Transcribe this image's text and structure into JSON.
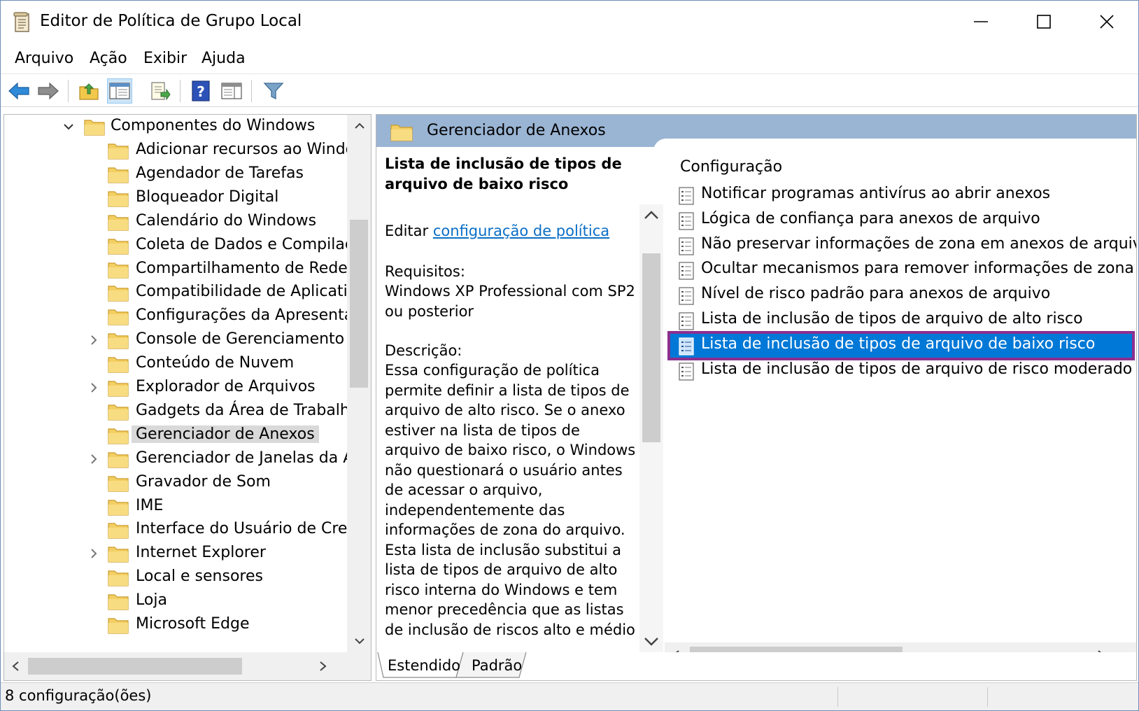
{
  "window": {
    "title": "Editor de Política de Grupo Local"
  },
  "menu": {
    "items": [
      "Arquivo",
      "Ação",
      "Exibir",
      "Ajuda"
    ]
  },
  "toolbar": {
    "buttons": [
      "back-arrow-icon",
      "forward-arrow-icon",
      "up-folder-icon",
      "show-hide-tree-icon",
      "export-list-icon",
      "help-icon",
      "show-hide-action-pane-icon",
      "filter-icon"
    ]
  },
  "tree": {
    "parent": "Componentes do Windows",
    "items": [
      {
        "label": "Adicionar recursos ao Windo",
        "expandable": false
      },
      {
        "label": "Agendador de Tarefas",
        "expandable": false
      },
      {
        "label": "Bloqueador Digital",
        "expandable": false
      },
      {
        "label": "Calendário do Windows",
        "expandable": false
      },
      {
        "label": "Coleta de Dados e Compilaçã",
        "expandable": false
      },
      {
        "label": "Compartilhamento de Rede",
        "expandable": false
      },
      {
        "label": "Compatibilidade de Aplicativ",
        "expandable": false
      },
      {
        "label": "Configurações da Apresentaç",
        "expandable": false
      },
      {
        "label": "Console de Gerenciamento M",
        "expandable": true
      },
      {
        "label": "Conteúdo de Nuvem",
        "expandable": false
      },
      {
        "label": "Explorador de Arquivos",
        "expandable": true
      },
      {
        "label": "Gadgets da Área de Trabalho",
        "expandable": false
      },
      {
        "label": "Gerenciador de Anexos",
        "expandable": false,
        "selected": true
      },
      {
        "label": "Gerenciador de Janelas da Ár",
        "expandable": true
      },
      {
        "label": "Gravador de Som",
        "expandable": false
      },
      {
        "label": "IME",
        "expandable": false
      },
      {
        "label": "Interface do Usuário de Crede",
        "expandable": false
      },
      {
        "label": "Internet Explorer",
        "expandable": true
      },
      {
        "label": "Local e sensores",
        "expandable": false
      },
      {
        "label": "Loja",
        "expandable": false
      },
      {
        "label": "Microsoft Edge",
        "expandable": false
      }
    ]
  },
  "header": {
    "title": "Gerenciador de Anexos"
  },
  "description": {
    "title": "Lista de inclusão de tipos de arquivo de baixo risco",
    "edit_prefix": "Editar",
    "edit_link": "configuração de política",
    "requirements_label": "Requisitos:",
    "requirements_text": "Windows XP Professional com SP2 ou posterior",
    "description_label": "Descrição:",
    "description_text": "Essa configuração de política permite definir a lista de tipos de arquivo de alto risco. Se o anexo estiver na lista de tipos de arquivo de baixo risco, o Windows não questionará o usuário antes de acessar o arquivo, independentemente das informações de zona do arquivo. Esta lista de inclusão substitui a lista de tipos de arquivo de alto risco interna do Windows e tem menor precedência que as listas de inclusão de riscos alto e médio"
  },
  "settings": {
    "column_header": "Configuração",
    "items": [
      "Notificar programas antivírus ao abrir anexos",
      "Lógica de confiança para anexos de arquivo",
      "Não preservar informações de zona em anexos de arquivo",
      "Ocultar mecanismos para remover informações de zona",
      "Nível de risco padrão para anexos de arquivo",
      "Lista de inclusão de tipos de arquivo de alto risco",
      "Lista de inclusão de tipos de arquivo de baixo risco",
      "Lista de inclusão de tipos de arquivo de risco moderado"
    ],
    "selected_index": 6
  },
  "tabs": {
    "extended": "Estendido",
    "standard": "Padrão"
  },
  "status": {
    "text": "8 configuração(ões)"
  },
  "colors": {
    "selection": "#0078d7",
    "highlight_border": "#8b2f8f",
    "header_band": "#9ab4d3",
    "link": "#0b6ec5"
  }
}
